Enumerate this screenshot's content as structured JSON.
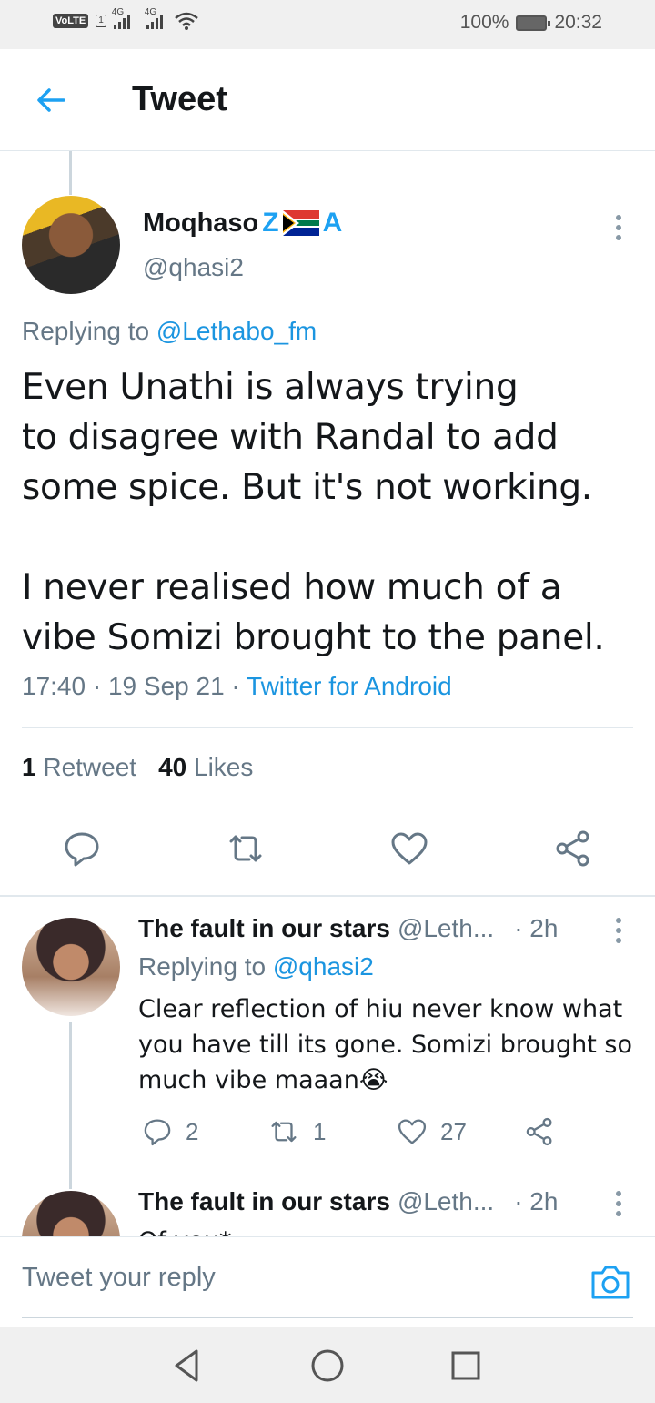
{
  "status_bar": {
    "volte": "VoLTE",
    "sim": "1",
    "net1": "4G",
    "net2": "4G",
    "battery": "100%",
    "time": "20:32"
  },
  "header": {
    "title": "Tweet"
  },
  "main_tweet": {
    "name": "Moqhaso",
    "name_emoji_left": "Z",
    "name_emoji_right": "A",
    "handle": "@qhasi2",
    "replying_prefix": "Replying to",
    "replying_to": "@Lethabo_fm",
    "text": "Even Unathi is always trying\nto disagree with Randal to add\nsome spice. But it's not working.\n\nI never realised how much of a\nvibe Somizi brought to the panel.",
    "time": "17:40",
    "date": "19 Sep 21",
    "source": "Twitter for Android",
    "retweet_count": "1",
    "retweet_label": "Retweet",
    "like_count": "40",
    "like_label": "Likes"
  },
  "replies": [
    {
      "name": "The fault in our stars",
      "handle": "@Leth...",
      "time": "· 2h",
      "replying_prefix": "Replying to",
      "replying_to": "@qhasi2",
      "text": "Clear reflection of hiu never know what you have till its gone. Somizi brought so much vibe maaan😭",
      "reply_count": "2",
      "retweet_count": "1",
      "like_count": "27"
    },
    {
      "name": "The fault in our stars",
      "handle": "@Leth...",
      "time": "· 2h",
      "text": "Of you*"
    }
  ],
  "reply_bar": {
    "placeholder": "Tweet your reply"
  },
  "colors": {
    "accent": "#1da1f2",
    "link": "#1b95e0",
    "muted": "#657786",
    "text": "#14171a"
  },
  "icons": [
    "back-arrow-icon",
    "more-icon",
    "reply-icon",
    "retweet-icon",
    "like-icon",
    "share-icon",
    "camera-icon",
    "nav-back-icon",
    "nav-home-icon",
    "nav-recents-icon"
  ]
}
